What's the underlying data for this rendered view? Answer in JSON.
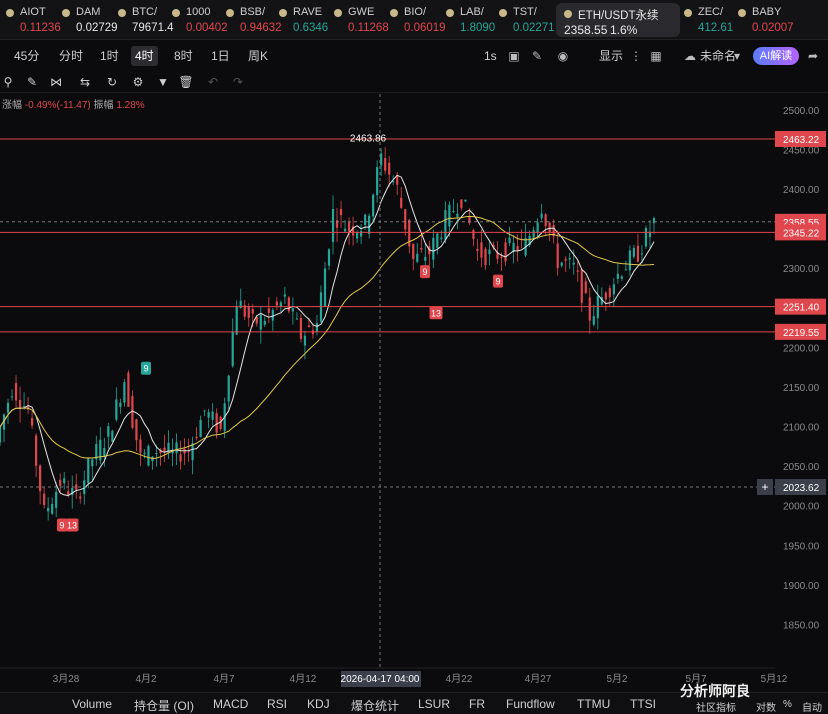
{
  "ticker": [
    {
      "symbol": "AIOT",
      "price": "0.11236",
      "color": "#e0474c"
    },
    {
      "symbol": "DAM",
      "price": "0.02729",
      "color": "#e8e8e8"
    },
    {
      "symbol": "BTC/",
      "price": "79671.4",
      "color": "#e8e8e8"
    },
    {
      "symbol": "1000",
      "price": "0.00402",
      "color": "#e0474c"
    },
    {
      "symbol": "BSB/",
      "price": "0.94632",
      "color": "#e0474c"
    },
    {
      "symbol": "RAVE",
      "price": "0.6346",
      "color": "#26a69a"
    },
    {
      "symbol": "GWE",
      "price": "0.11268",
      "color": "#e0474c"
    },
    {
      "symbol": "BIO/",
      "price": "0.06019",
      "color": "#e0474c"
    },
    {
      "symbol": "LAB/",
      "price": "1.8090",
      "color": "#26a69a"
    },
    {
      "symbol": "TST/",
      "price": "0.02271",
      "color": "#26a69a"
    },
    {
      "symbol": "ETH/USDT永续",
      "price": "2358.55",
      "pct": "1.6%",
      "active": true
    },
    {
      "symbol": "ZEC/",
      "price": "412.61",
      "color": "#26a69a"
    },
    {
      "symbol": "BABY",
      "price": "0.02007",
      "color": "#e0474c"
    }
  ],
  "timeframes": [
    "45分",
    "分时",
    "1时",
    "4时",
    "8时",
    "1日",
    "周K"
  ],
  "timeframe_selected": "4时",
  "toolbar_right": {
    "interval": "1s",
    "display": "显示",
    "layout_name": "未命名",
    "ai": "AI解读"
  },
  "amplitude": {
    "label_change": "涨幅",
    "change": "-0.49%(-11.47)",
    "label_amp": "振幅",
    "amp": "1.28%"
  },
  "indicators": [
    "Volume",
    "持仓量 (OI)",
    "MACD",
    "RSI",
    "KDJ",
    "爆仓统计",
    "LSUR",
    "FR",
    "Fundflow",
    "TTMU",
    "TTSI"
  ],
  "watermark": "分析师阿良",
  "footer_right": [
    "社区指标",
    "对数",
    "%",
    "自动"
  ],
  "colors": {
    "up": "#26a69a",
    "down": "#e0474c",
    "ma_fast": "#e6e6e6",
    "ma_slow": "#e3c84a",
    "hline": "#e0474c"
  },
  "chart_data": {
    "type": "candlestick",
    "symbol": "ETH/USDT永续",
    "interval": "4时",
    "y_ticks": [
      2500,
      2450,
      2400,
      2350,
      2300,
      2250,
      2200,
      2150,
      2100,
      2050,
      2000,
      1950,
      1900,
      1850
    ],
    "ylim": [
      1795,
      2520
    ],
    "x_ticks": [
      "3月28",
      "4月2",
      "4月7",
      "4月12",
      "4月22",
      "4月27",
      "5月2",
      "5月7",
      "5月12"
    ],
    "crosshair": {
      "x_label": "2026-04-17 04:00",
      "y_label": "2023.62"
    },
    "horizontal_lines": [
      2463.22,
      2251.4,
      2219.55,
      2345.22
    ],
    "current_price": "2358.55",
    "peak_label": "2463.86",
    "right_labels": [
      "2463.22",
      "2358.55",
      "2345.22",
      "2251.40",
      "2219.55",
      "2023.62"
    ],
    "td_labels": [
      {
        "text": "9",
        "kind": "up",
        "x": "4月1",
        "price": 2173
      },
      {
        "text": "9",
        "kind": "down",
        "x": "3月27",
        "price": 1975
      },
      {
        "text": "13",
        "kind": "down",
        "x": "3月28",
        "price": 1975
      },
      {
        "text": "9",
        "kind": "down",
        "x": "4月18",
        "price": 2295
      },
      {
        "text": "13",
        "kind": "down",
        "x": "4月19",
        "price": 2243
      },
      {
        "text": "9",
        "kind": "down",
        "x": "4月24",
        "price": 2283
      }
    ],
    "price_path": [
      {
        "x": "3月24",
        "close": 2080
      },
      {
        "x": "3月25",
        "close": 2150
      },
      {
        "x": "3月26",
        "close": 2120
      },
      {
        "x": "3月27",
        "close": 1990
      },
      {
        "x": "3月28",
        "close": 2030
      },
      {
        "x": "3月29",
        "close": 2010
      },
      {
        "x": "3月30",
        "close": 2060
      },
      {
        "x": "3月31",
        "close": 2090
      },
      {
        "x": "4月1",
        "close": 2160
      },
      {
        "x": "4月2",
        "close": 2060
      },
      {
        "x": "4月3",
        "close": 2070
      },
      {
        "x": "4月4",
        "close": 2065
      },
      {
        "x": "4月5",
        "close": 2070
      },
      {
        "x": "4月6",
        "close": 2120
      },
      {
        "x": "4月7",
        "close": 2095
      },
      {
        "x": "4月8",
        "close": 2260
      },
      {
        "x": "4月9",
        "close": 2230
      },
      {
        "x": "4月10",
        "close": 2240
      },
      {
        "x": "4月11",
        "close": 2260
      },
      {
        "x": "4月12",
        "close": 2215
      },
      {
        "x": "4月13",
        "close": 2230
      },
      {
        "x": "4月14",
        "close": 2370
      },
      {
        "x": "4月15",
        "close": 2350
      },
      {
        "x": "4月16",
        "close": 2355
      },
      {
        "x": "4月17",
        "close": 2440
      },
      {
        "x": "4月18",
        "close": 2400
      },
      {
        "x": "4月19",
        "close": 2310
      },
      {
        "x": "4月20",
        "close": 2320
      },
      {
        "x": "4月21",
        "close": 2360
      },
      {
        "x": "4月22",
        "close": 2390
      },
      {
        "x": "4月23",
        "close": 2320
      },
      {
        "x": "4月24",
        "close": 2315
      },
      {
        "x": "4月25",
        "close": 2325
      },
      {
        "x": "4月26",
        "close": 2330
      },
      {
        "x": "4月27",
        "close": 2380
      },
      {
        "x": "4月28",
        "close": 2310
      },
      {
        "x": "4月29",
        "close": 2300
      },
      {
        "x": "4月30",
        "close": 2240
      },
      {
        "x": "5月1",
        "close": 2270
      },
      {
        "x": "5月2",
        "close": 2300
      },
      {
        "x": "5月3",
        "close": 2320
      },
      {
        "x": "5月4",
        "close": 2358
      }
    ]
  }
}
